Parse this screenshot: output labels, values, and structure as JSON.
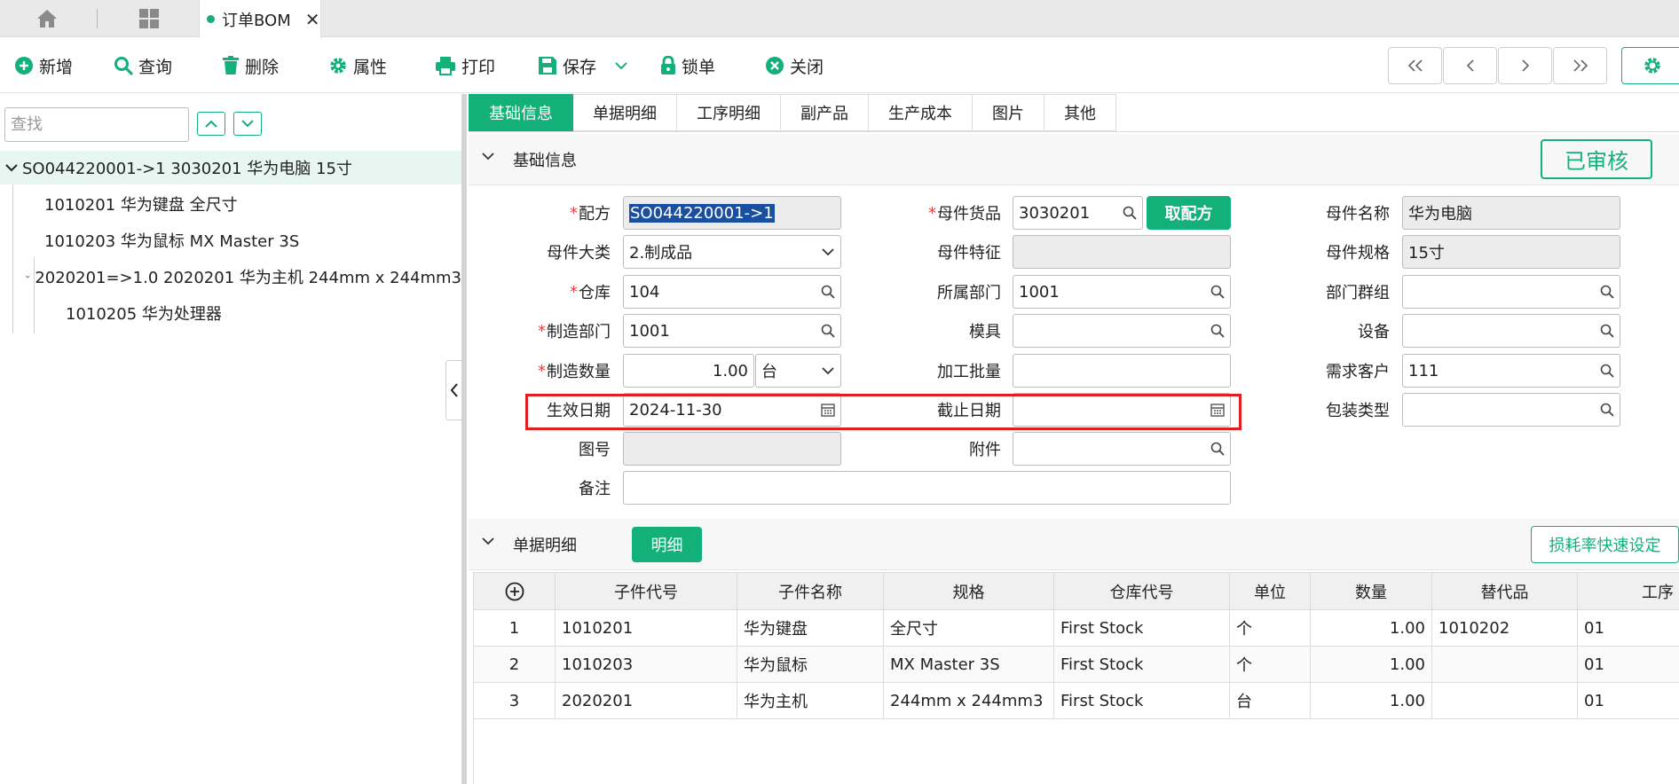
{
  "tabbar": {
    "doc_tab": "订单BOM",
    "close": "✕"
  },
  "toolbar": {
    "add": "新增",
    "query": "查询",
    "delete": "删除",
    "properties": "属性",
    "print": "打印",
    "save": "保存",
    "lock": "锁单",
    "close": "关闭"
  },
  "tree": {
    "search_placeholder": "查找",
    "items": [
      "SO044220001->1 3030201 华为电脑 15寸",
      "1010201 华为键盘 全尺寸",
      "1010203 华为鼠标 MX Master 3S",
      "2020201=>1.0 2020201 华为主机 244mm x 244mm3",
      "1010205 华为处理器"
    ]
  },
  "tabs": [
    "基础信息",
    "单据明细",
    "工序明细",
    "副产品",
    "生产成本",
    "图片",
    "其他"
  ],
  "basic": {
    "section_title": "基础信息",
    "status": "已审核",
    "take_formula": "取配方",
    "labels": {
      "formula": "配方",
      "parent_item": "母件货品",
      "parent_name": "母件名称",
      "parent_category": "母件大类",
      "parent_feature": "母件特征",
      "parent_spec": "母件规格",
      "warehouse": "仓库",
      "dept": "所属部门",
      "dept_group": "部门群组",
      "mfg_dept": "制造部门",
      "mold": "模具",
      "equipment": "设备",
      "mfg_qty": "制造数量",
      "batch": "加工批量",
      "customer": "需求客户",
      "effective_date": "生效日期",
      "end_date": "截止日期",
      "packing": "包装类型",
      "drawing_no": "图号",
      "attachment": "附件",
      "remark": "备注"
    },
    "values": {
      "formula": "SO044220001->1",
      "parent_item": "3030201",
      "parent_name": "华为电脑",
      "parent_category": "2.制成品",
      "parent_feature": "",
      "parent_spec": "15寸",
      "warehouse": "104",
      "dept": "1001",
      "dept_group": "",
      "mfg_dept": "1001",
      "mold": "",
      "equipment": "",
      "mfg_qty": "1.00",
      "unit": "台",
      "batch": "",
      "customer": "111",
      "effective_date": "2024-11-30",
      "end_date": "",
      "packing": "",
      "drawing_no": "",
      "attachment": "",
      "remark": ""
    }
  },
  "detail": {
    "section_title": "单据明细",
    "detail_button": "明细",
    "loss_button": "损耗率快速设定",
    "columns": [
      "子件代号",
      "子件名称",
      "规格",
      "仓库代号",
      "单位",
      "数量",
      "替代品",
      "工序"
    ],
    "rows": [
      {
        "no": "1",
        "code": "1010201",
        "name": "华为键盘",
        "spec": "全尺寸",
        "wh": "First Stock",
        "unit": "个",
        "qty": "1.00",
        "sub": "1010202",
        "proc": "01"
      },
      {
        "no": "2",
        "code": "1010203",
        "name": "华为鼠标",
        "spec": "MX Master 3S",
        "wh": "First Stock",
        "unit": "个",
        "qty": "1.00",
        "sub": "",
        "proc": "01"
      },
      {
        "no": "3",
        "code": "2020201",
        "name": "华为主机",
        "spec": "244mm x 244mm3",
        "wh": "First Stock",
        "unit": "台",
        "qty": "1.00",
        "sub": "",
        "proc": "01"
      }
    ]
  },
  "colors": {
    "accent": "#14b079",
    "required": "#e84040",
    "highlight": "#e02020"
  }
}
